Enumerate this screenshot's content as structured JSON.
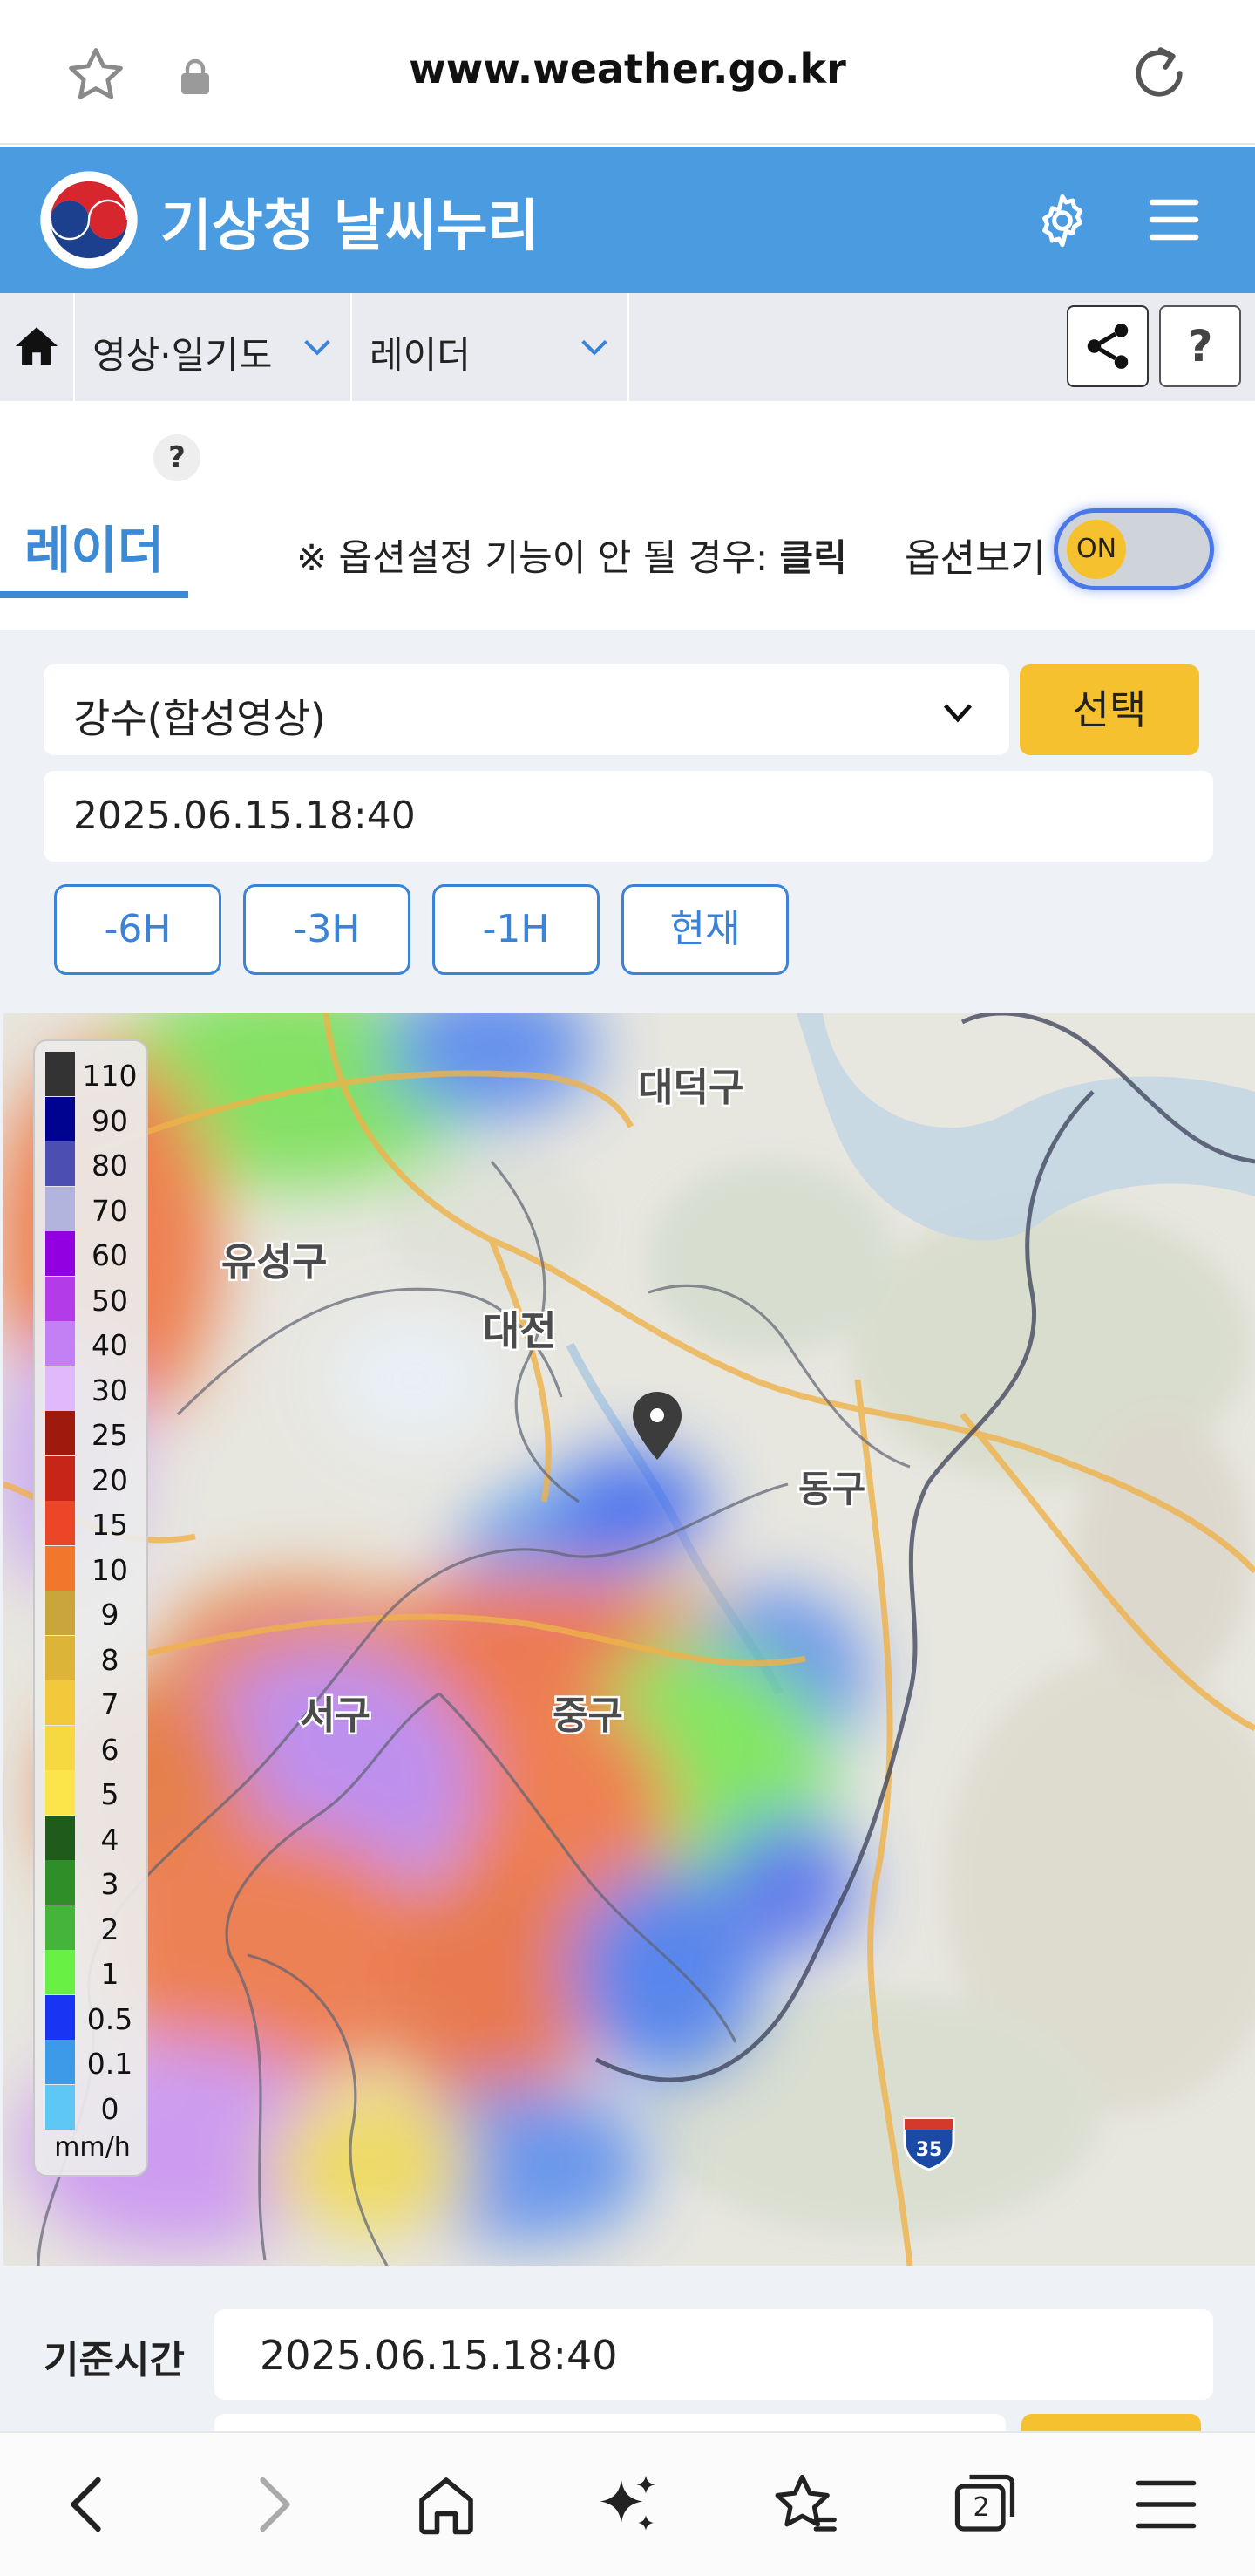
{
  "browser": {
    "url": "www.weather.go.kr",
    "tab_count": "2",
    "icons": [
      "star-icon",
      "lock-icon",
      "reload-icon",
      "back-icon",
      "forward-icon",
      "home-icon",
      "sparkle-icon",
      "favorites-icon",
      "tabs-icon",
      "menu-icon"
    ]
  },
  "site": {
    "title": "기상청 날씨누리",
    "icons": [
      "kma-logo",
      "gear-icon",
      "menu-icon"
    ]
  },
  "breadcrumb": {
    "items": [
      {
        "label": "영상·일기도"
      },
      {
        "label": "레이더"
      }
    ],
    "help_label": "?"
  },
  "radar_tab": {
    "label": "레이더",
    "help_badge": "?",
    "notice_prefix": "※ 옵션설정 기능이 안 될 경우: ",
    "notice_link": "클릭",
    "options_label": "옵션보기",
    "toggle_state": "ON"
  },
  "controls": {
    "product_select": "강수(합성영상)",
    "select_button": "선택",
    "datetime": "2025.06.15.18:40",
    "time_buttons": [
      "-6H",
      "-3H",
      "-1H",
      "현재"
    ]
  },
  "map": {
    "labels": {
      "daedeok": "대덕구",
      "yuseong": "유성구",
      "daejeon": "대전",
      "donggu": "동구",
      "seogu": "서구",
      "junggu": "중구",
      "highway": "35"
    },
    "legend": {
      "unit": "mm/h",
      "levels": [
        "110",
        "90",
        "80",
        "70",
        "60",
        "50",
        "40",
        "30",
        "25",
        "20",
        "15",
        "10",
        "9",
        "8",
        "7",
        "6",
        "5",
        "4",
        "3",
        "2",
        "1",
        "0.5",
        "0.1",
        "0"
      ],
      "colors": [
        "#333333",
        "#000390",
        "#4c4eb1",
        "#b3b4de",
        "#9200e1",
        "#b33ce8",
        "#c37ff4",
        "#e0b9fc",
        "#9e1a0d",
        "#c72518",
        "#eb4628",
        "#f0772c",
        "#c9a53c",
        "#dcb437",
        "#f2c93a",
        "#f6d840",
        "#fbe54a",
        "#1f5c1c",
        "#2f8e27",
        "#44b43a",
        "#68f045",
        "#1934f2",
        "#3d9ae8",
        "#5ec7f4"
      ]
    }
  },
  "reference": {
    "label": "기준시간",
    "datetime": "2025.06.15.18:40"
  }
}
